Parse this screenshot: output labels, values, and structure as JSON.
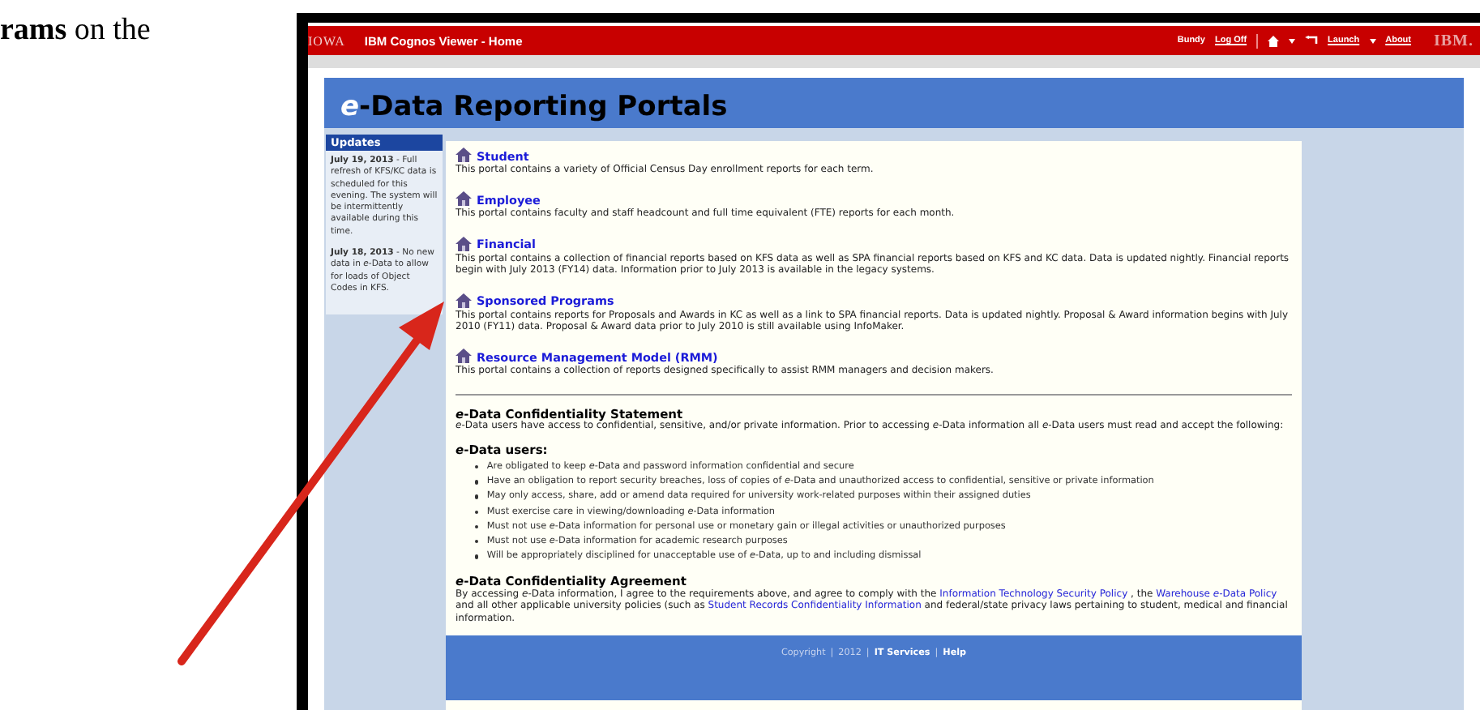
{
  "document_text": "**rams** on the",
  "header": {
    "logo": "IOWA",
    "title": "IBM Cognos Viewer - Home",
    "user": "Bundy",
    "log_off": "Log Off",
    "launch": "Launch",
    "about": "About",
    "brand": "IBM."
  },
  "page_title": {
    "prefix": "e",
    "text": "-Data Reporting Portals"
  },
  "updates": {
    "heading": "Updates",
    "items": [
      {
        "text": "**July 19, 2013** - Full refresh of KFS/KC data is scheduled for this evening. The system will be intermittently available during this time."
      },
      {
        "text": "**July 18, 2013** - No new data in *e*-Data to allow for loads of Object Codes in KFS."
      }
    ]
  },
  "portals": [
    {
      "title": "Student",
      "description": "This portal contains a variety of Official Census Day enrollment reports for each term."
    },
    {
      "title": "Employee",
      "description": "This portal contains faculty and staff headcount and full time equivalent (FTE) reports for each month."
    },
    {
      "title": "Financial",
      "description": "This portal contains a collection of financial reports based on KFS data as well as SPA financial reports based on KFS and KC data. Data is updated nightly. Financial reports begin with July 2013 (FY14) data. Information prior to July 2013 is available in the legacy systems."
    },
    {
      "title": "Sponsored Programs",
      "description": "This portal contains reports for Proposals and Awards in KC as well as a link to SPA financial reports. Data is updated nightly. Proposal & Award information begins with July 2010 (FY11) data. Proposal & Award data prior to July 2010 is still available using InfoMaker."
    },
    {
      "title": "Resource Management Model (RMM)",
      "description": "This portal contains a collection of reports designed specifically to assist RMM managers and decision makers."
    }
  ],
  "statement": {
    "heading": "*e*-Data Confidentiality Statement",
    "text": "*e*-Data users have access to confidential, sensitive, and/or private information. Prior to accessing *e*-Data information all *e*-Data users must read and accept the following:"
  },
  "users": {
    "heading": "*e*-Data users:",
    "items": [
      "Are obligated to keep *e*-Data and password information confidential and secure",
      "Have an obligation to report security breaches, loss of copies of *e*-Data and unauthorized access to confidential, sensitive or private information",
      "May only access, share, add or amend data required for university work-related purposes within their assigned duties",
      "Must exercise care in viewing/downloading *e*-Data information",
      "Must not use *e*-Data information for personal use or monetary gain or illegal activities or unauthorized purposes",
      "Must not use *e*-Data information for academic research purposes",
      "Will be appropriately disciplined for unacceptable use of *e*-Data, up to and including dismissal"
    ]
  },
  "agreement": {
    "heading": "*e*-Data Confidentiality Agreement",
    "segments": [
      {
        "kind": "text",
        "text": "By accessing *e*-Data information, I agree to the requirements above, and agree to comply with the "
      },
      {
        "kind": "link",
        "text": "Information Technology Security Policy"
      },
      {
        "kind": "text",
        "text": " , the "
      },
      {
        "kind": "link",
        "text": "Warehouse *e*-Data Policy"
      },
      {
        "kind": "text",
        "text": " and all other applicable university policies (such as "
      },
      {
        "kind": "link",
        "text": "Student Records Confidentiality Information"
      },
      {
        "kind": "text",
        "text": " and federal/state privacy laws pertaining to student, medical and financial information."
      }
    ]
  },
  "footer": [
    {
      "kind": "text",
      "text": "Copyright"
    },
    {
      "kind": "sep",
      "text": "|"
    },
    {
      "kind": "text",
      "text": "2012"
    },
    {
      "kind": "sep",
      "text": "|"
    },
    {
      "kind": "link",
      "text": "IT Services"
    },
    {
      "kind": "sep",
      "text": "|"
    },
    {
      "kind": "link",
      "text": "Help"
    }
  ]
}
